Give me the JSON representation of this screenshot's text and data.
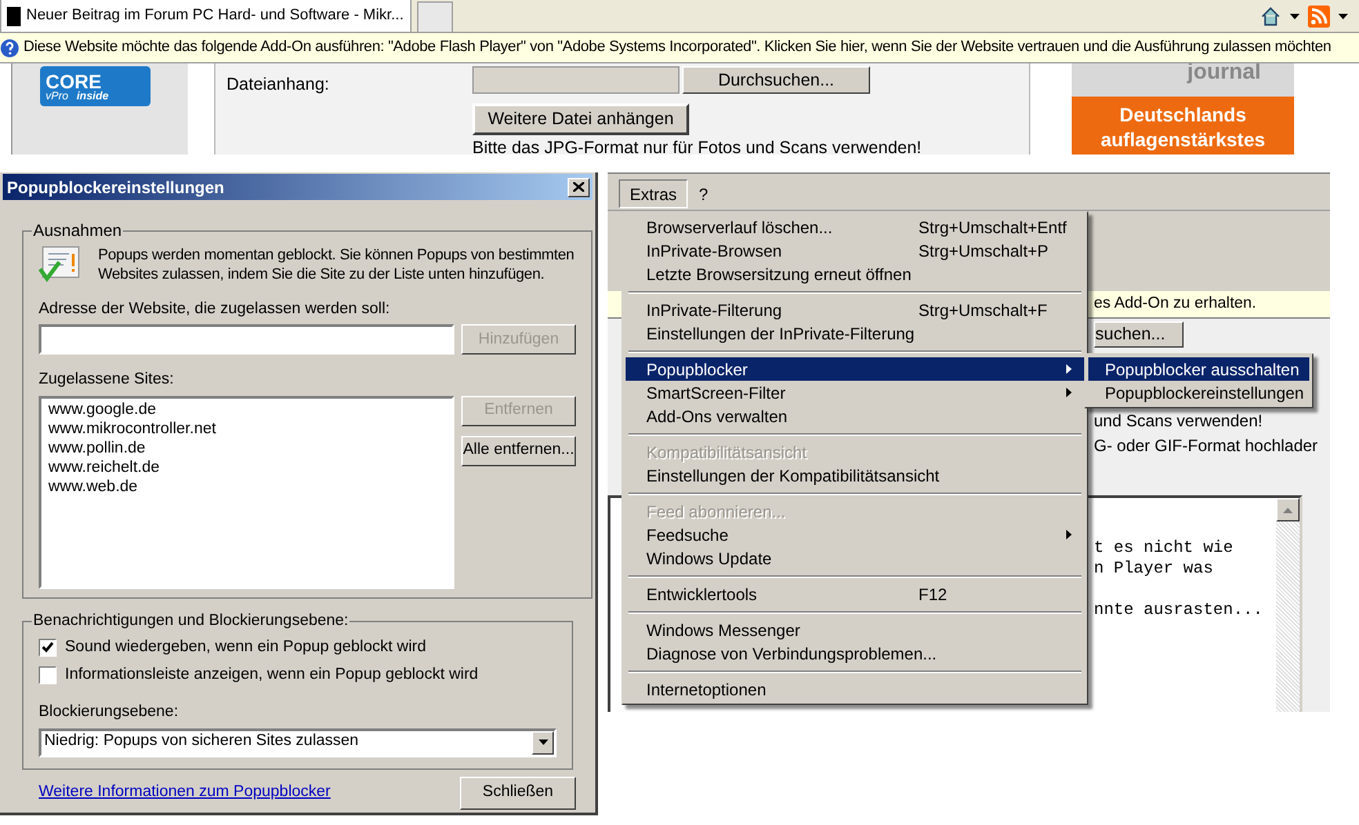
{
  "browser": {
    "tabs": [
      {
        "label": "Neuer Beitrag im Forum PC Hard- und Software - Mikr...",
        "selected": true
      }
    ],
    "infobar": "Diese Website möchte das folgende Add-On ausführen: \"Adobe Flash Player\" von \"Adobe Systems Incorporated\". Klicken Sie hier, wenn Sie der Website vertrauen und die Ausführung zulassen möchten",
    "page": {
      "logo": {
        "brand": "CORE",
        "line": "vPro",
        "suffix": "inside"
      },
      "attachment_label": "Dateianhang:",
      "browse_button": "Durchsuchen...",
      "add_file_button": "Weitere Datei anhängen",
      "note": "Bitte das JPG-Format nur für Fotos und Scans verwenden!",
      "ad": {
        "brand": "journal",
        "headline": "Deutschlands auflagenstärkstes"
      }
    }
  },
  "dialog": {
    "title": "Popupblockereinstellungen",
    "exceptions": {
      "legend": "Ausnahmen",
      "info": "Popups werden momentan geblockt. Sie können Popups von bestimmten Websites zulassen, indem Sie die Site zu der Liste unten hinzufügen.",
      "address_label": "Adresse der Website, die zugelassen werden soll:",
      "add_button": {
        "label": "Hinzufügen",
        "disabled": true
      },
      "sites_label": "Zugelassene Sites:",
      "sites": [
        "www.google.de",
        "www.mikrocontroller.net",
        "www.pollin.de",
        "www.reichelt.de",
        "www.web.de"
      ],
      "remove_button": {
        "label": "Entfernen",
        "disabled": true
      },
      "remove_all_button": {
        "label": "Alle entfernen...",
        "disabled": false
      }
    },
    "notifications": {
      "legend": "Benachrichtigungen und Blockierungsebene:",
      "options": [
        {
          "label": "Sound wiedergeben, wenn ein Popup geblockt wird",
          "checked": true
        },
        {
          "label": "Informationsleiste anzeigen, wenn ein Popup geblockt wird",
          "checked": false
        }
      ],
      "level_label": "Blockierungsebene:",
      "level_value": "Niedrig: Popups von sicheren Sites zulassen"
    },
    "more_info_link": "Weitere Informationen zum Popupblocker",
    "close_button": "Schließen"
  },
  "menu_window": {
    "menubar": [
      {
        "label": "Extras",
        "selected": true
      },
      {
        "label": "?",
        "selected": false
      }
    ],
    "background": {
      "infobar": "es Add-On zu erhalten.",
      "browse_button": "suchen...",
      "lines": [
        "und Scans verwenden!",
        "G- oder GIF-Format hochlader"
      ],
      "textarea_lines": [
        {
          "text": "t es nicht wie",
          "blank_before": false
        },
        {
          "text": "n Player was",
          "blank_before": false
        },
        {
          "text": "nnte ausrasten...",
          "blank_before": true
        }
      ]
    },
    "menu": [
      [
        {
          "label": "Browserverlauf löschen...",
          "shortcut": "Strg+Umschalt+Entf",
          "disabled": false,
          "selected": false,
          "submenu": false
        },
        {
          "label": "InPrivate-Browsen",
          "shortcut": "Strg+Umschalt+P",
          "disabled": false,
          "selected": false,
          "submenu": false
        },
        {
          "label": "Letzte Browsersitzung erneut öffnen",
          "disabled": false,
          "selected": false,
          "submenu": false
        }
      ],
      [
        {
          "label": "InPrivate-Filterung",
          "shortcut": "Strg+Umschalt+F",
          "disabled": false,
          "selected": false,
          "submenu": false
        },
        {
          "label": "Einstellungen der InPrivate-Filterung",
          "disabled": false,
          "selected": false,
          "submenu": false
        }
      ],
      [
        {
          "label": "Popupblocker",
          "disabled": false,
          "selected": true,
          "submenu": true
        },
        {
          "label": "SmartScreen-Filter",
          "disabled": false,
          "selected": false,
          "submenu": true
        },
        {
          "label": "Add-Ons verwalten",
          "disabled": false,
          "selected": false,
          "submenu": false
        }
      ],
      [
        {
          "label": "Kompatibilitätsansicht",
          "disabled": true,
          "selected": false,
          "submenu": false
        },
        {
          "label": "Einstellungen der Kompatibilitätsansicht",
          "disabled": false,
          "selected": false,
          "submenu": false
        }
      ],
      [
        {
          "label": "Feed abonnieren...",
          "disabled": true,
          "selected": false,
          "submenu": false
        },
        {
          "label": "Feedsuche",
          "disabled": false,
          "selected": false,
          "submenu": true
        },
        {
          "label": "Windows Update",
          "disabled": false,
          "selected": false,
          "submenu": false
        }
      ],
      [
        {
          "label": "Entwicklertools",
          "shortcut": "F12",
          "disabled": false,
          "selected": false,
          "submenu": false
        }
      ],
      [
        {
          "label": "Windows Messenger",
          "disabled": false,
          "selected": false,
          "submenu": false
        },
        {
          "label": "Diagnose von Verbindungsproblemen...",
          "disabled": false,
          "selected": false,
          "submenu": false
        }
      ],
      [
        {
          "label": "Internetoptionen",
          "disabled": false,
          "selected": false,
          "submenu": false
        }
      ]
    ],
    "submenu": [
      {
        "label": "Popupblocker ausschalten",
        "selected": true
      },
      {
        "label": "Popupblockereinstellungen",
        "selected": false
      }
    ]
  }
}
